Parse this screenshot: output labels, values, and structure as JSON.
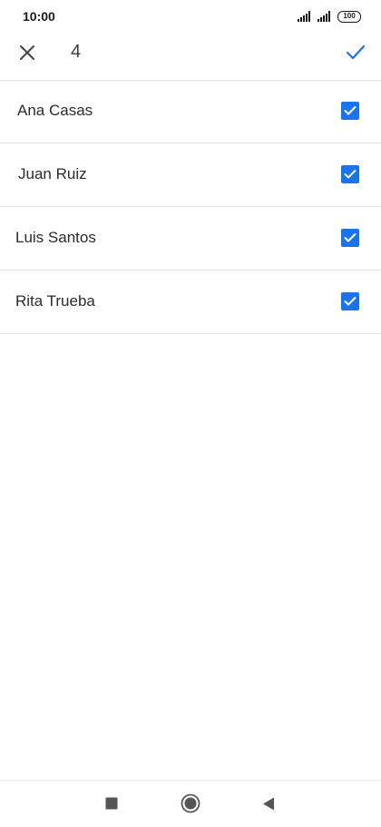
{
  "status_bar": {
    "time": "10:00",
    "battery": "100",
    "icons": [
      "signal-icon",
      "signal-icon",
      "battery-icon"
    ]
  },
  "app_bar": {
    "selected_count": "4",
    "icons": [
      "close-icon",
      "check-icon"
    ]
  },
  "contacts": [
    {
      "name": "Ana Casas",
      "checked": true
    },
    {
      "name": "Juan Ruiz",
      "checked": true
    },
    {
      "name": "Luis Santos",
      "checked": true
    },
    {
      "name": "Rita Trueba",
      "checked": true
    }
  ],
  "nav_bar": {
    "icons": [
      "recents-square-icon",
      "home-circle-icon",
      "back-triangle-icon"
    ]
  },
  "colors": {
    "accent": "#1a73e8",
    "text": "#2b2b2b",
    "divider": "#e2e2e2",
    "nav_icon": "#555555"
  }
}
